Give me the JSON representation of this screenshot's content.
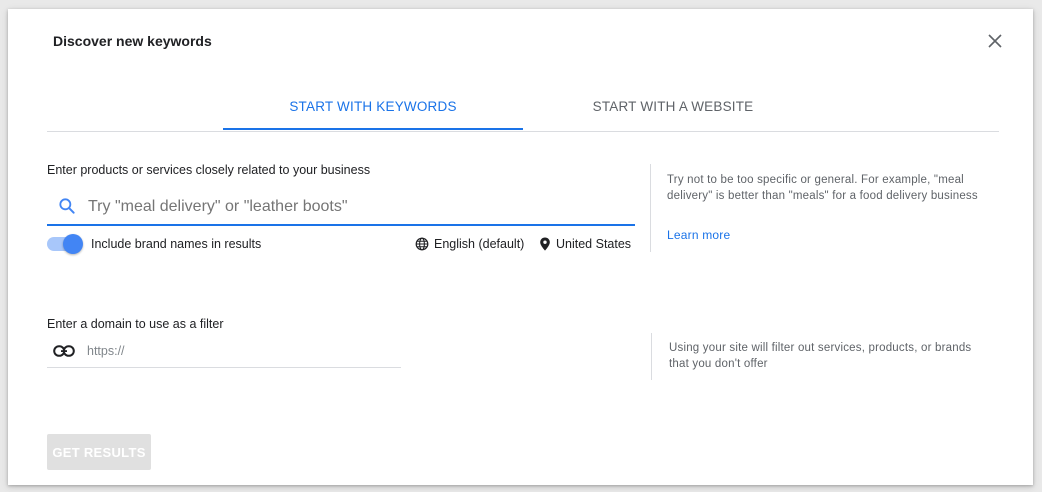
{
  "dialog": {
    "title": "Discover new keywords",
    "close_icon": "close-icon"
  },
  "tabs": [
    {
      "label": "START WITH KEYWORDS",
      "active": true
    },
    {
      "label": "START WITH A WEBSITE",
      "active": false
    }
  ],
  "keywords": {
    "label": "Enter products or services closely related to your business",
    "search_placeholder": "Try \"meal delivery\" or \"leather boots\"",
    "search_value": "",
    "search_icon": "search-icon",
    "brand_toggle_label": "Include brand names in results",
    "brand_toggle_on": true,
    "language": "English (default)",
    "language_icon": "globe-icon",
    "location": "United States",
    "location_icon": "location-pin-icon",
    "help_text": "Try not to be too specific or general. For example, \"meal delivery\" is better than \"meals\" for a food delivery business",
    "learn_more": "Learn more"
  },
  "domain": {
    "label": "Enter a domain to use as a filter",
    "placeholder": "https://",
    "value": "",
    "link_icon": "link-icon",
    "help_text": "Using your site will filter out services, products, or brands that you don't offer"
  },
  "actions": {
    "get_results_label": "GET RESULTS",
    "get_results_enabled": false
  },
  "colors": {
    "accent": "#1a73e8",
    "toggle_thumb": "#4285f4",
    "toggle_track": "#a8c7fa",
    "disabled_button": "#e0e0e0",
    "help_text": "#5f6368"
  }
}
